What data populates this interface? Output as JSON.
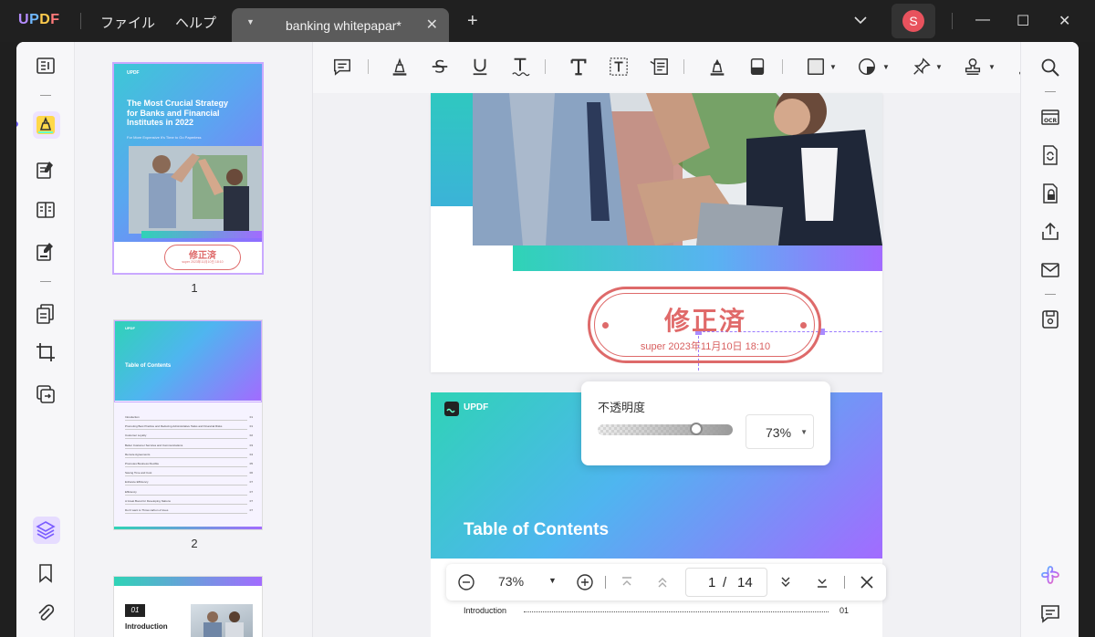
{
  "titlebar": {
    "logo": {
      "u": "U",
      "p": "P",
      "d": "D",
      "f": "F"
    },
    "menus": [
      "ファイル",
      "ヘルプ"
    ],
    "tab_name": "banking whitepapar*",
    "tab_close": "✕",
    "new_tab": "+",
    "avatar_initial": "S",
    "window_controls": {
      "minimize": "—",
      "maximize": "☐",
      "close": "✕"
    }
  },
  "thumbnails": {
    "page1": {
      "brand": "UPDF",
      "title": "The Most Crucial Strategy for Banks and Financial Institutes in 2022",
      "subtitle": "For More Expensive It's Time to Go Paperless",
      "stamp_title": "修正済",
      "stamp_sub": "super 2023年11月10日 18:10",
      "number": "1"
    },
    "page2": {
      "brand": "UPDF",
      "title": "Table of Contents",
      "number": "2",
      "toc": [
        "Introduction",
        "Promoting Best Practice and Reducing Administrative Tasks and Financial Risks",
        "Customer Loyalty",
        "Better Customer Services and Communications",
        "Remote Agreements",
        "Promotes Business Flexible",
        "Saving Time and Cost",
        "Enhance Efficiency",
        "Efficiency",
        "A Great Boost for Developing Nations",
        "Don't want to Throw carbon of trees"
      ],
      "toc_pages": [
        "01",
        "01",
        "02",
        "03",
        "04",
        "05",
        "06",
        "07",
        "07",
        "07",
        "07"
      ]
    },
    "page3": {
      "badge": "01",
      "heading": "Introduction"
    }
  },
  "document": {
    "stamp": {
      "title": "修正済",
      "subtitle": "super 2023年11月10日 18:10"
    },
    "page2": {
      "brand": "UPDF",
      "title": "Table of Contents",
      "first_entry": "Introduction",
      "first_entry_page": "01"
    }
  },
  "opacity_popover": {
    "label": "不透明度",
    "value": "73%",
    "level": 0.73
  },
  "zoombar": {
    "zoom": "73%",
    "current_page": "1",
    "separator": "/",
    "total_pages": "14"
  },
  "colors": {
    "accent": "#a98bff",
    "stamp": "#de6a6a",
    "gradient_start": "#2fd3b6",
    "gradient_end": "#a26bff"
  },
  "icons": {
    "left_rail": [
      "reader-icon",
      "comment-highlighter-icon",
      "edit-pdf-icon",
      "organize-pages-icon",
      "fill-sign-icon",
      "page-tools-icon",
      "crop-icon",
      "convert-icon",
      "layers-icon",
      "bookmark-icon",
      "attachment-icon"
    ],
    "right_rail": [
      "search-icon",
      "ocr-icon",
      "convert-pdf-icon",
      "protect-icon",
      "share-icon",
      "email-icon",
      "save-icon",
      "ai-icon",
      "chat-icon"
    ]
  }
}
